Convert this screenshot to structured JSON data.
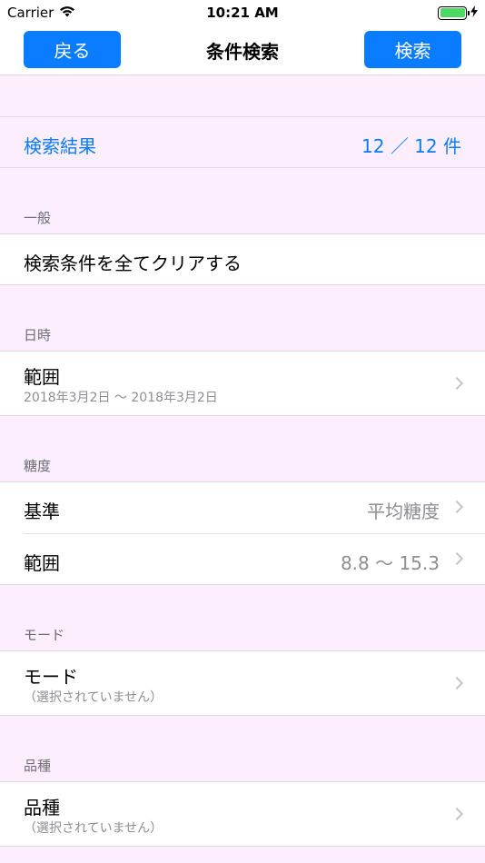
{
  "status_bar": {
    "carrier": "Carrier",
    "time": "10:21 AM",
    "battery_percent": 100
  },
  "nav": {
    "back_label": "戻る",
    "title": "条件検索",
    "search_label": "検索"
  },
  "results": {
    "label": "検索結果",
    "count": "12 ／ 12 件"
  },
  "sections": {
    "general": {
      "header": "一般",
      "clear_label": "検索条件を全てクリアする"
    },
    "datetime": {
      "header": "日時",
      "range_label": "範囲",
      "range_value": "2018年3月2日 〜 2018年3月2日"
    },
    "sugar": {
      "header": "糖度",
      "basis_label": "基準",
      "basis_value": "平均糖度",
      "range_label": "範囲",
      "range_value": "8.8 〜 15.3"
    },
    "mode": {
      "header": "モード",
      "label": "モード",
      "value": "（選択されていません）"
    },
    "variety": {
      "header": "品種",
      "label": "品種",
      "value": "（選択されていません）"
    }
  },
  "colors": {
    "accent": "#0a7cff",
    "background": "#fdeefd",
    "battery": "#4cd964"
  }
}
